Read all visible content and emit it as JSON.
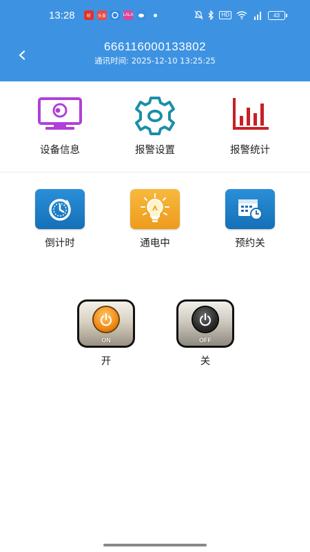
{
  "status_bar": {
    "time": "13:28",
    "apps": [
      {
        "icon": "music-app-icon",
        "text": "听",
        "color": "#e0342b"
      },
      {
        "icon": "news-app-icon",
        "text": "头条",
        "color": "#e84b4b"
      },
      {
        "icon": "browser-app-icon",
        "text": "",
        "color": "#2f86e0"
      },
      {
        "icon": "video-app-icon",
        "text": "LALA",
        "color": "#d6489e"
      },
      {
        "icon": "cloud-app-icon",
        "text": "",
        "color": "#3b8de0"
      }
    ],
    "hd_label": "HD",
    "signal_label": "5G",
    "battery": "43"
  },
  "header": {
    "device_id": "666116000133802",
    "comm_time_label": "通讯时间:",
    "comm_time_value": "2025-12-10 13:25:25"
  },
  "menu": [
    {
      "label": "设备信息",
      "icon": "monitor-icon"
    },
    {
      "label": "报警设置",
      "icon": "gear-icon"
    },
    {
      "label": "报警统计",
      "icon": "bar-chart-icon"
    }
  ],
  "status": [
    {
      "label": "倒计时",
      "icon": "timer-icon"
    },
    {
      "label": "通电中",
      "icon": "lightbulb-icon"
    },
    {
      "label": "预约关",
      "icon": "calendar-clock-icon"
    }
  ],
  "power": {
    "on_text": "ON",
    "off_text": "OFF",
    "on_label": "开",
    "off_label": "关"
  },
  "colors": {
    "header": "#3d93e2",
    "purple": "#b040d8",
    "teal": "#1a8fa8",
    "red": "#c82024",
    "blue_tile": "#1a7fcf",
    "orange_tile": "#f3a62b"
  }
}
